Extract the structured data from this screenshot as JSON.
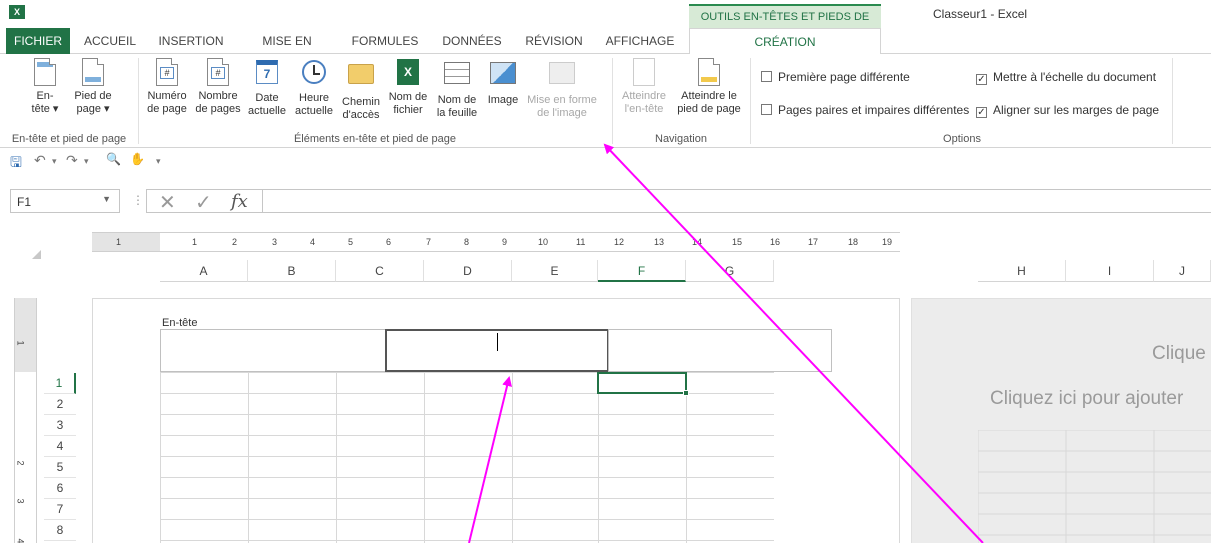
{
  "window": {
    "app_logo": "X",
    "tools_header": "OUTILS EN-TÊTES ET PIEDS DE PAGE",
    "title": "Classeur1 - Excel"
  },
  "tabs": {
    "fichier": "FICHIER",
    "accueil": "ACCUEIL",
    "insertion": "INSERTION",
    "mise_en_page": "MISE EN PAGE",
    "formules": "FORMULES",
    "donnees": "DONNÉES",
    "revision": "RÉVISION",
    "affichage": "AFFICHAGE",
    "creation": "CRÉATION"
  },
  "ribbon": {
    "buttons": {
      "en_tete_1": "En-",
      "en_tete_2": "tête ▾",
      "pied_1": "Pied de",
      "pied_2": "page ▾",
      "numero_1": "Numéro",
      "numero_2": "de page",
      "nombre_1": "Nombre",
      "nombre_2": "de pages",
      "date_1": "Date",
      "date_2": "actuelle",
      "heure_1": "Heure",
      "heure_2": "actuelle",
      "chemin_1": "Chemin",
      "chemin_2": "d'accès",
      "nomfichier_1": "Nom de",
      "nomfichier_2": "fichier",
      "nomfeuille_1": "Nom de",
      "nomfeuille_2": "la feuille",
      "image": "Image",
      "miseforme_1": "Mise en forme",
      "miseforme_2": "de l'image",
      "atteindre_entete_1": "Atteindre",
      "atteindre_entete_2": "l'en-tête",
      "atteindre_pied_1": "Atteindre le",
      "atteindre_pied_2": "pied de page",
      "calendar_num": "7"
    },
    "groups": {
      "entete_pied": "En-tête et pied de page",
      "elements": "Éléments en-tête et pied de page",
      "navigation": "Navigation",
      "options": "Options"
    },
    "options": {
      "premiere_page": "Première page différente",
      "paires_impaires": "Pages paires et impaires différentes",
      "echelle": "Mettre à l'échelle du document",
      "aligner": "Aligner sur les marges de page",
      "check_mark": "✓"
    }
  },
  "quick_access": {
    "save_glyph": "🖫",
    "undo_glyph": "↶",
    "undo_dd": "▾",
    "redo_glyph": "↷",
    "redo_dd": "▾",
    "preview_glyph": "🔍",
    "touch_glyph": "✋",
    "customize_glyph": "▾"
  },
  "formula_bar": {
    "name_box": "F1",
    "name_dd": "▼",
    "sep": "⋮",
    "cancel": "✕",
    "enter": "✓",
    "fx": "fx",
    "value": ""
  },
  "ruler": {
    "numbers": [
      "1",
      "1",
      "2",
      "3",
      "4",
      "5",
      "6",
      "7",
      "8",
      "9",
      "10",
      "11",
      "12",
      "13",
      "14",
      "15",
      "16",
      "17",
      "18",
      "19"
    ],
    "v_numbers": [
      "1",
      "2",
      "3",
      "4"
    ]
  },
  "columns": [
    "A",
    "B",
    "C",
    "D",
    "E",
    "F",
    "G",
    "H",
    "I",
    "J"
  ],
  "rows": [
    "1",
    "2",
    "3",
    "4",
    "5",
    "6",
    "7",
    "8"
  ],
  "page": {
    "header_label": "En-tête",
    "page2_text1": "Clique",
    "page2_text2": "Cliquez ici pour ajouter"
  },
  "colors": {
    "excel_green": "#217346",
    "arrow": "#ff00ff"
  }
}
